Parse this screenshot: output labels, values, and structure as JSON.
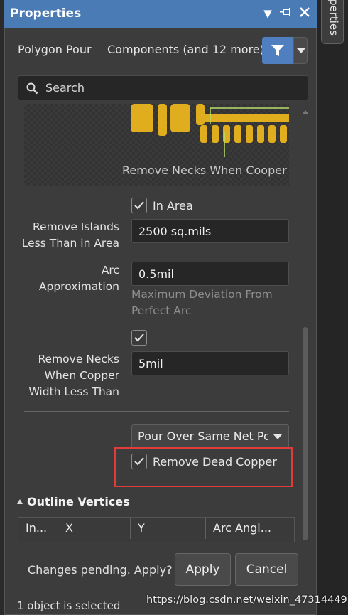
{
  "panel": {
    "title": "Properties",
    "side_tab": "perties"
  },
  "header": {
    "object_type": "Polygon Pour",
    "filter_scope": "Components (and 12 more)"
  },
  "search": {
    "placeholder": "Search"
  },
  "preview": {
    "caption": "Remove Necks When Cooper"
  },
  "fields": {
    "in_area_label": "In Area",
    "remove_islands_label": "Remove Islands Less Than in Area",
    "remove_islands_line1": "Remove Islands",
    "remove_islands_line2": "Less Than in Area",
    "remove_islands_value": "2500 sq.mils",
    "arc_label_line1": "Arc",
    "arc_label_line2": "Approximation",
    "arc_value": "0.5mil",
    "arc_hint_line1": "Maximum Deviation From",
    "arc_hint_line2": "Perfect Arc",
    "necks_line1": "Remove Necks",
    "necks_line2": "When Copper",
    "necks_line3": "Width Less Than",
    "necks_value": "5mil",
    "pour_mode": "Pour Over Same Net Po",
    "remove_dead_copper_label": "Remove Dead Copper"
  },
  "checkboxes": {
    "in_area": true,
    "remove_necks": true,
    "remove_dead_copper": true
  },
  "outline": {
    "section_title": "Outline Vertices",
    "columns": [
      "In...",
      "X",
      "Y",
      "Arc Angl..."
    ]
  },
  "footer": {
    "pending_text": "Changes pending. Apply?",
    "apply_label": "Apply",
    "cancel_label": "Cancel",
    "status_text": "1 object is selected",
    "watermark": "https://blog.csdn.net/weixin_47314449"
  },
  "colors": {
    "titlebar": "#4a7bb5",
    "accent": "#4f7fbf",
    "highlight_box": "#e23b3b",
    "pad_yellow": "#e0ad1e",
    "track_green": "#b7e06a"
  },
  "icons": {
    "dropdown": "triangle-down-icon",
    "pin": "pin-icon",
    "close": "close-icon",
    "filter": "filter-icon",
    "search": "search-icon",
    "check": "checkmark-icon",
    "collapse": "triangle-up-icon"
  }
}
